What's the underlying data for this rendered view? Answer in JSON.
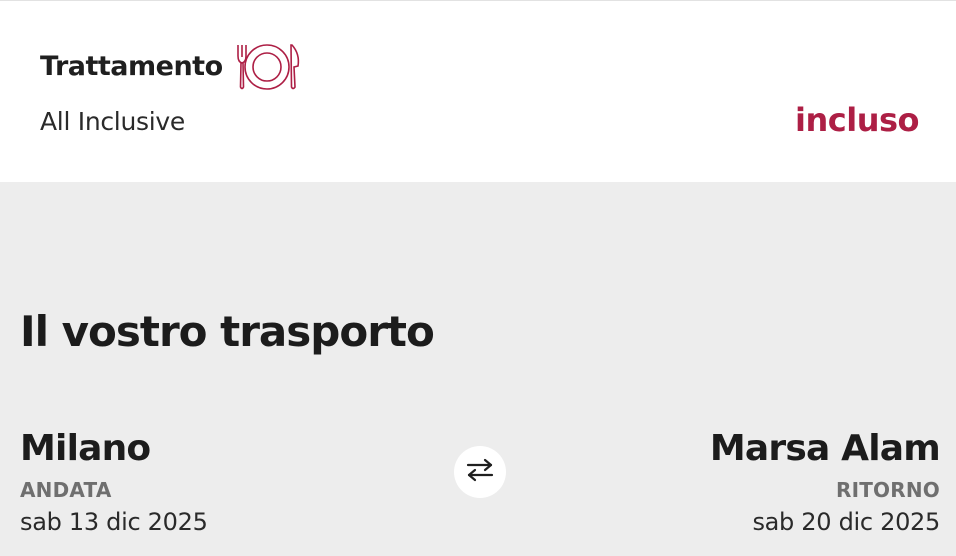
{
  "treatment": {
    "title": "Trattamento",
    "icon": "plate-fork-knife-icon",
    "value": "All Inclusive",
    "status": "incluso",
    "accent_color": "#ad1f45"
  },
  "transport": {
    "title": "Il vostro trasporto",
    "outbound": {
      "city": "Milano",
      "label": "ANDATA",
      "date": "sab 13 dic 2025"
    },
    "return": {
      "city": "Marsa Alam",
      "label": "RITORNO",
      "date": "sab 20 dic 2025"
    },
    "swap_icon": "swap-arrows-icon"
  }
}
